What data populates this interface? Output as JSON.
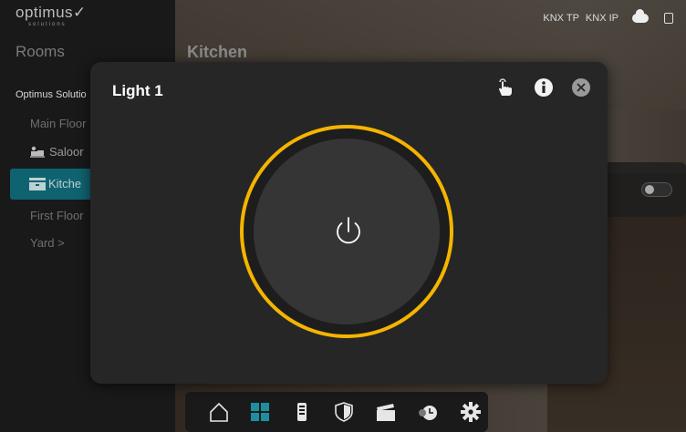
{
  "app": {
    "logo_text": "optimus",
    "logo_sub": "solutions",
    "status": {
      "knx_tp": "KNX TP",
      "knx_ip": "KNX IP"
    }
  },
  "sidebar": {
    "heading": "Rooms",
    "project": "Optimus Solutio",
    "items": [
      {
        "label": "Main Floor",
        "icon": "none"
      },
      {
        "label": "Saloor",
        "icon": "sofa-icon"
      },
      {
        "label": "Kitche",
        "icon": "kitchen-icon",
        "selected": true
      },
      {
        "label": "First Floor",
        "icon": "none"
      },
      {
        "label": "Yard >",
        "icon": "none"
      }
    ]
  },
  "main": {
    "room_title": "Kitchen"
  },
  "dialog": {
    "title": "Light 1",
    "power_state": "on",
    "accent_color": "#f4b400",
    "actions": [
      "touch-icon",
      "info-icon",
      "close-icon"
    ]
  },
  "bottom_nav": {
    "items": [
      "home-icon",
      "rooms-grid-icon",
      "remote-icon",
      "security-shield-icon",
      "scenes-clapper-icon",
      "timer-icon",
      "settings-gear-icon"
    ],
    "active": "rooms-grid-icon"
  }
}
